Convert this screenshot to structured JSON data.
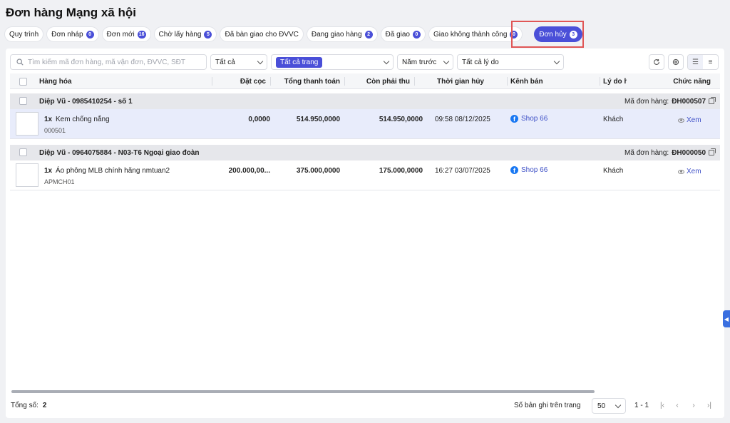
{
  "page": {
    "title": "Đơn hàng Mạng xã hội"
  },
  "tabs": [
    {
      "label": "Quy trình",
      "badge": ""
    },
    {
      "label": "Đơn nháp",
      "badge": "0"
    },
    {
      "label": "Đơn mới",
      "badge": "16"
    },
    {
      "label": "Chờ lấy hàng",
      "badge": "5"
    },
    {
      "label": "Đã bàn giao cho ĐVVC",
      "badge": ""
    },
    {
      "label": "Đang giao hàng",
      "badge": "2"
    },
    {
      "label": "Đã giao",
      "badge": "0"
    },
    {
      "label": "Giao không thành công",
      "badge": "0"
    },
    {
      "label": "Đơn hủy",
      "badge": "3",
      "active": true
    }
  ],
  "filters": {
    "search_placeholder": "Tìm kiếm mã đơn hàng, mã vận đơn, ĐVVC, SĐT",
    "status_value": "Tất cả",
    "page_value": "Tất cả trang",
    "period_value": "Năm trước",
    "reason_value": "Tất cả lý do"
  },
  "table": {
    "columns": {
      "product": "Hàng hóa",
      "deposit": "Đặt cọc",
      "total": "Tổng thanh toán",
      "remaining": "Còn phải thu",
      "cancel_time": "Thời gian hủy",
      "channel": "Kênh bán",
      "reason": "Lý do h",
      "actions": "Chức năng"
    },
    "order_id_label": "Mã đơn hàng:",
    "view_label": "Xem",
    "groups": [
      {
        "customer": "Diệp Vũ - 0985410254 - số 1",
        "order_id": "ĐH000507",
        "qty": "1x",
        "product_name": "Kem chống nắng",
        "sku": "000501",
        "deposit": "0,0000",
        "total": "514.950,0000",
        "remaining": "514.950,0000",
        "cancel_time": "09:58 08/12/2025",
        "channel": "Shop 66",
        "reason": "Khách"
      },
      {
        "customer": "Diệp Vũ - 0964075884 - N03-T6 Ngoại giao đoàn",
        "order_id": "ĐH000050",
        "qty": "1x",
        "product_name": "Áo phông MLB chính hãng nmtuan2",
        "sku": "APMCH01",
        "deposit": "200.000,00...",
        "total": "375.000,0000",
        "remaining": "175.000,0000",
        "cancel_time": "16:27 03/07/2025",
        "channel": "Shop 66",
        "reason": "Khách"
      }
    ]
  },
  "footer": {
    "total_label": "Tổng số:",
    "total_value": "2",
    "per_page_label": "Số bản ghi trên trang",
    "per_page_value": "50",
    "range": "1 - 1"
  },
  "colors": {
    "accent": "#4a4fd8",
    "highlight_border": "#e05656",
    "selected_row": "#e8ecfb"
  }
}
